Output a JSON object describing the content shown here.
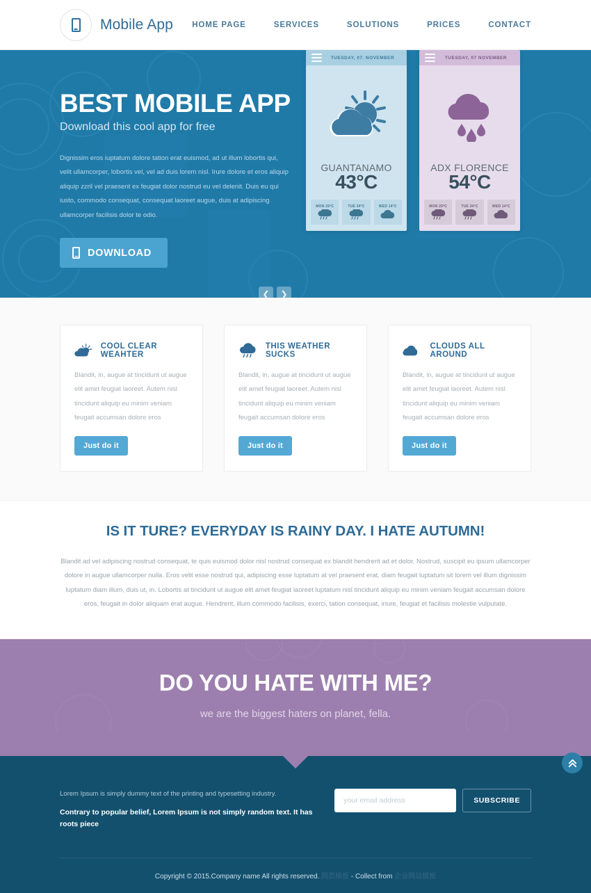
{
  "header": {
    "brand": "Mobile App",
    "brand_icon": "mobile-phone-icon",
    "nav": [
      {
        "label": "HOME PAGE"
      },
      {
        "label": "SERVICES"
      },
      {
        "label": "SOLUTIONS"
      },
      {
        "label": "PRICES"
      },
      {
        "label": "CONTACT"
      }
    ]
  },
  "hero": {
    "title": "BEST MOBILE APP",
    "subtitle": "Download this cool app for free",
    "body": "Dignissim eros iuptatum dolore tation erat euismod, ad ut illum lobortis qui, velit ullamcorper, lobortis vel, vel ad duis lorem nisl. Irure dolore et eros aliquip aliquip zzril vel praesent ex feugiat dolor nostrud eu vel delenit. Duis eu qui iusto, commodo consequat, consequat laoreet augue, duis at adipiscing ullamcorper facilisis dolor te odio.",
    "download_label": "DOWNLOAD",
    "download_icon": "mobile-phone-icon",
    "prev_icon": "chevron-left-icon",
    "next_icon": "chevron-right-icon",
    "bg_color": "#1f7aa8",
    "button_color": "#4ba3cf"
  },
  "phones": [
    {
      "theme": "blue",
      "date": "TUESDAY, 07. NOVEMBER",
      "weather_icon": "sun-behind-cloud-icon",
      "city": "GUANTANAMO",
      "temp": "43°C",
      "forecast": [
        {
          "label": "MON  29°C",
          "icon": "rain-cloud-icon"
        },
        {
          "label": "TUE   34°C",
          "icon": "rain-cloud-icon"
        },
        {
          "label": "WED  14°C",
          "icon": "cloud-icon"
        }
      ]
    },
    {
      "theme": "purple",
      "date": "TUESDAY, 07  NOVEMBER",
      "weather_icon": "rain-cloud-icon",
      "city": "ADX FLORENCE",
      "temp": "54°C",
      "forecast": [
        {
          "label": "MON  29°C",
          "icon": "rain-cloud-icon"
        },
        {
          "label": "TUE   34°C",
          "icon": "rain-cloud-icon"
        },
        {
          "label": "WED  14°C",
          "icon": "cloud-icon"
        }
      ]
    }
  ],
  "cards": [
    {
      "icon": "sun-behind-cloud-icon",
      "title": "COOL CLEAR WEAHTER",
      "body": "Blandit, in, augue at tincidunt ut augue elit amet feugiat laoreet. Autem nisl tincidunt aliquip eu minim veniam feugait accumsan dolore eros",
      "button": "Just do it"
    },
    {
      "icon": "rain-cloud-icon",
      "title": "THIS WEATHER SUCKS",
      "body": "Blandit, in, augue at tincidunt ut augue elit amet feugiat laoreet. Autem nisl tincidunt aliquip eu minim veniam feugait accumsan dolore eros",
      "button": "Just do it"
    },
    {
      "icon": "cloud-icon",
      "title": "CLOUDS ALL AROUND",
      "body": "Blandit, in, augue at tincidunt ut augue elit amet feugiat laoreet. Autem nisl tincidunt aliquip eu minim veniam feugait accumsan dolore eros",
      "button": "Just do it"
    }
  ],
  "statement": {
    "heading": "IS IT TURE? EVERYDAY IS RAINY DAY. I HATE AUTUMN!",
    "paragraph": "Blandit ad vel adipiscing nostrud consequat, te quis euismod dolor nisl nostrud consequat ex blandit hendrerit ad et dolor. Nostrud, suscipit eu ipsum ullamcorper dolore in augue ullamcorper nulla. Eros velit esse nostrud qui, adipiscing esse luptatum at vel praesent erat, diam feugait luptatum sit lorem vel illum dignissim luptatum diam illum, duis ut, in. Lobortis at tincidunt ut augue elit amet feugiat laoreet luptatum nisl tincidunt aliquip eu minim veniam feugait accumsan dolore eros, feugait in dolor aliquam erat augue. Hendrent, illum commodo facilisis, exerci, tation consequat, iriure, feugiat et facilisis molestie vulputate."
  },
  "cta": {
    "heading": "DO YOU HATE WITH ME?",
    "subheading": "we are the biggest haters on planet, fella.",
    "bg_color": "#9c7fae"
  },
  "footer": {
    "line1": "Lorem Ipsum is simply dummy text of the printing and typesetting industry.",
    "line2": "Contrary to popular belief, Lorem Ipsum is not simply random text. It has roots piece",
    "email_placeholder": "your email address",
    "email_value": "",
    "subscribe_label": "SUBSCRIBE",
    "copyright": "Copyright © 2015.Company name All rights reserved.",
    "copyright_faint_1": "网页模板",
    "copyright_mid": "- Collect from",
    "copyright_faint_2": "企业网站模板",
    "to_top_icon": "double-chevron-up-icon",
    "bg_color": "#13506e"
  }
}
